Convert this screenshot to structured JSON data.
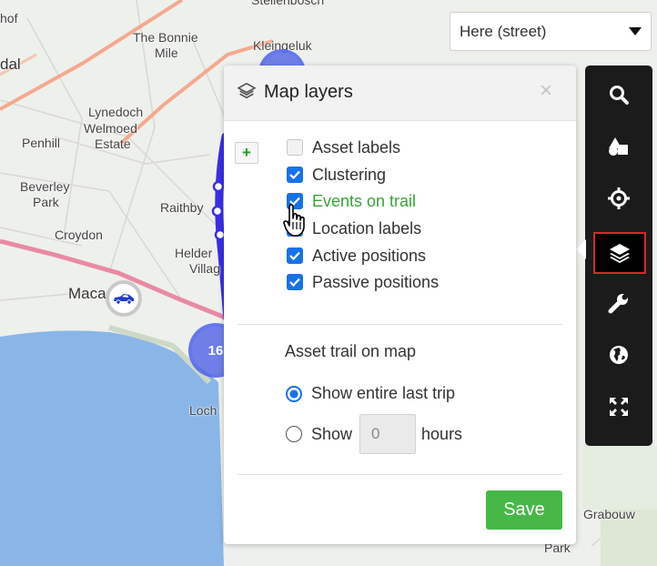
{
  "map": {
    "labels": {
      "kleingeluk": "Kleingeluk",
      "the_bonnie": "The Bonnie",
      "mile": "Mile",
      "lynedoch": "Lynedoch",
      "welmoed": "Welmoed",
      "estate": "Estate",
      "penhill": "Penhill",
      "beverley": "Beverley",
      "park": "Park",
      "croydon": "Croydon",
      "raithby": "Raithby",
      "helder": "Helder",
      "villa": "Villag",
      "macassar": "Maca",
      "loch": "Loch",
      "grabouw": "Grabouw",
      "park_bottom": "Park",
      "hof": "hof",
      "dal": "dal",
      "top_partial": "Stellenbosch"
    },
    "cluster_count": "16",
    "provider": {
      "selected": "Here (street)"
    }
  },
  "panel": {
    "title": "Map layers",
    "title_icon": "layers-icon",
    "close_label": "×",
    "add_label": "+",
    "layers": [
      {
        "label": "Asset labels",
        "checked": false
      },
      {
        "label": "Clustering",
        "checked": true
      },
      {
        "label": "Events on trail",
        "checked": true
      },
      {
        "label": "Location labels",
        "checked": true
      },
      {
        "label": "Active positions",
        "checked": true
      },
      {
        "label": "Passive positions",
        "checked": true
      }
    ],
    "trail": {
      "title": "Asset trail on map",
      "option_entire": "Show entire last trip",
      "option_show": "Show",
      "hours_value": "0",
      "hours_label": "hours",
      "selected": "entire"
    },
    "save_label": "Save"
  },
  "toolbar": {
    "tools": [
      {
        "icon": "search-icon"
      },
      {
        "icon": "shapes-icon"
      },
      {
        "icon": "crosshair-icon"
      },
      {
        "icon": "layers-icon",
        "active": true
      },
      {
        "icon": "wrench-icon"
      },
      {
        "icon": "globe-icon"
      },
      {
        "icon": "fullscreen-icon"
      }
    ]
  },
  "colors": {
    "accent": "#1672e8",
    "save": "#47b847",
    "highlight": "#3aa23a",
    "active_tool_border": "#d12a2a",
    "cluster": "#4a5ae6"
  }
}
